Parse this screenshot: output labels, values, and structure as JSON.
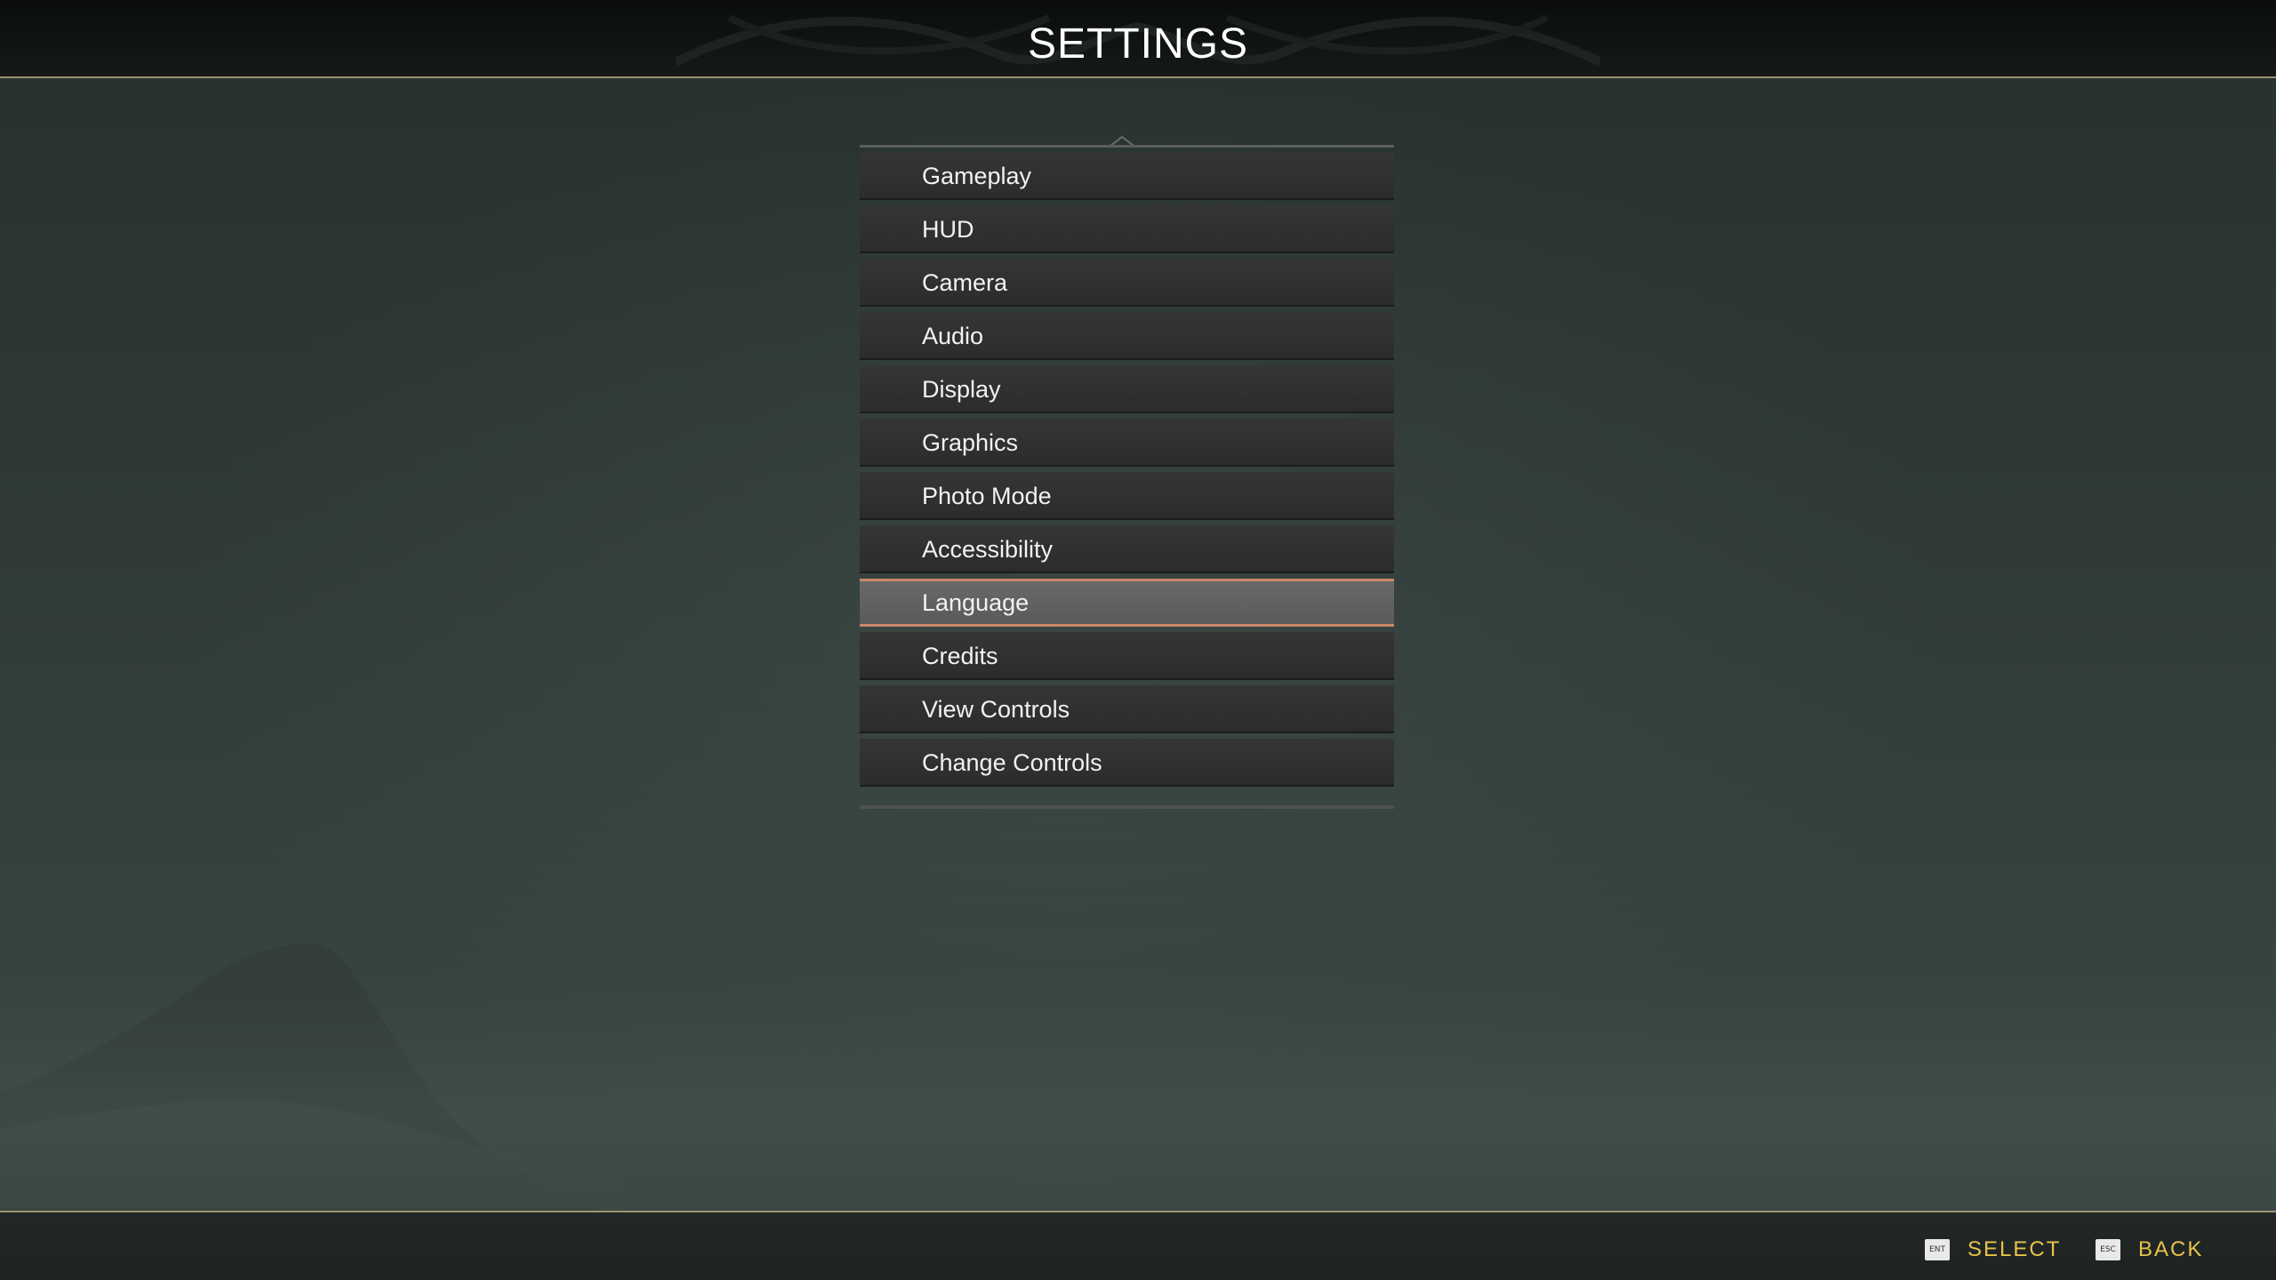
{
  "header": {
    "title": "SETTINGS"
  },
  "menu": {
    "items": [
      {
        "label": "Gameplay"
      },
      {
        "label": "HUD"
      },
      {
        "label": "Camera"
      },
      {
        "label": "Audio"
      },
      {
        "label": "Display"
      },
      {
        "label": "Graphics"
      },
      {
        "label": "Photo Mode"
      },
      {
        "label": "Accessibility"
      },
      {
        "label": "Language"
      },
      {
        "label": "Credits"
      },
      {
        "label": "View Controls"
      },
      {
        "label": "Change Controls"
      }
    ],
    "selected_label": "Language"
  },
  "footer": {
    "select": {
      "key": "ENT",
      "label": "SELECT"
    },
    "back": {
      "key": "ESC",
      "label": "BACK"
    }
  },
  "colors": {
    "accent_highlight": "#c9886a",
    "prompt_text": "#e8c24a",
    "header_rule": "#9a9270"
  }
}
